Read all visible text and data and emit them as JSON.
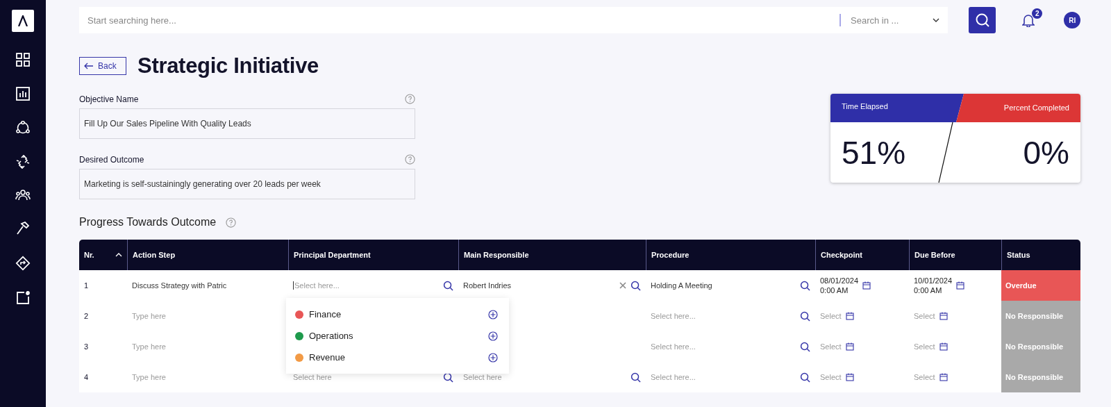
{
  "search": {
    "placeholder": "Start searching here...",
    "scope_placeholder": "Search in ..."
  },
  "notifications": {
    "count": "2"
  },
  "user": {
    "initials": "RI"
  },
  "back_button": "Back",
  "title": "Strategic Initiative",
  "fields": [
    {
      "label": "Objective Name",
      "value": "Fill Up Our Sales Pipeline With Quality Leads"
    },
    {
      "label": "Desired Outcome",
      "value": "Marketing is self-sustainingly generating over 20 leads per week"
    }
  ],
  "summary": {
    "time_elapsed": {
      "label": "Time Elapsed",
      "value": "51%"
    },
    "percent_completed": {
      "label": "Percent Completed",
      "value": "0%"
    }
  },
  "progress": {
    "heading": "Progress Towards Outcome",
    "table": {
      "columns": [
        {
          "label": "Nr.",
          "sort_ascending": true
        },
        {
          "label": "Action Step"
        },
        {
          "label": "Principal Department"
        },
        {
          "label": "Main Responsible"
        },
        {
          "label": "Procedure"
        },
        {
          "label": "Checkpoint"
        },
        {
          "label": "Due Before"
        },
        {
          "label": "Status"
        }
      ],
      "rows": [
        {
          "nr": "1",
          "action_step": {
            "value": "Discuss Strategy with Patric"
          },
          "principal_department": {
            "placeholder": "Select here...",
            "focused": true
          },
          "main_responsible": {
            "value": "Robert Indries",
            "clearable": true
          },
          "procedure": {
            "value": "Holding A Meeting"
          },
          "checkpoint": {
            "date": "08/01/2024",
            "time": "0:00 AM"
          },
          "due_before": {
            "date": "10/01/2024",
            "time": "0:00 AM"
          },
          "status": {
            "label": "Overdue",
            "kind": "overdue"
          }
        },
        {
          "nr": "2",
          "action_step": {
            "placeholder": "Type here"
          },
          "procedure": {
            "placeholder": "Select here..."
          },
          "checkpoint": {
            "placeholder": "Select"
          },
          "due_before": {
            "placeholder": "Select"
          },
          "status": {
            "label": "No Responsible",
            "kind": "no_responsible"
          }
        },
        {
          "nr": "3",
          "action_step": {
            "placeholder": "Type here"
          },
          "procedure": {
            "placeholder": "Select here..."
          },
          "checkpoint": {
            "placeholder": "Select"
          },
          "due_before": {
            "placeholder": "Select"
          },
          "status": {
            "label": "No Responsible",
            "kind": "no_responsible"
          }
        },
        {
          "nr": "4",
          "action_step": {
            "placeholder": "Type here"
          },
          "principal_department": {
            "placeholder": "Select here"
          },
          "main_responsible": {
            "placeholder": "Select here"
          },
          "procedure": {
            "placeholder": "Select here..."
          },
          "checkpoint": {
            "placeholder": "Select"
          },
          "due_before": {
            "placeholder": "Select"
          },
          "status": {
            "label": "No Responsible",
            "kind": "no_responsible"
          }
        }
      ]
    },
    "dropdown": {
      "options": [
        {
          "label": "Finance",
          "color": "#e85656"
        },
        {
          "label": "Operations",
          "color": "#1e9a4c"
        },
        {
          "label": "Revenue",
          "color": "#f29a45"
        }
      ]
    }
  }
}
